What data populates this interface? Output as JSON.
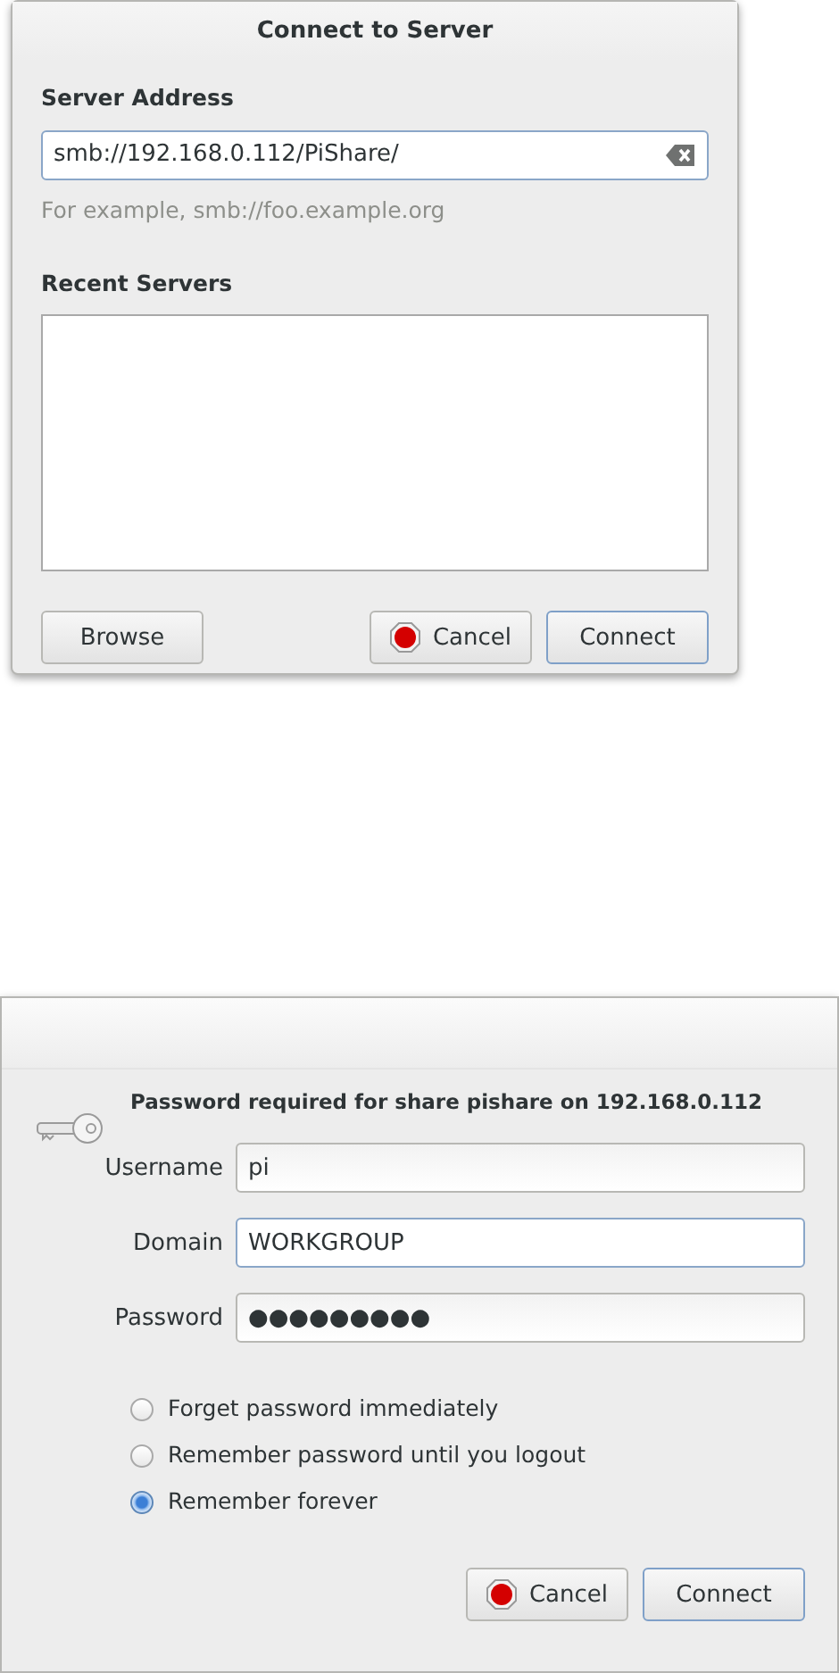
{
  "connect_dialog": {
    "title": "Connect to Server",
    "server_address_label": "Server Address",
    "address_field": {
      "value": "smb://192.168.0.112/PiShare/",
      "focused": true
    },
    "hint": "For example, smb://foo.example.org",
    "recent_servers_label": "Recent Servers",
    "buttons": [
      {
        "label": "Browse",
        "kind": "plain"
      },
      {
        "label": "Cancel",
        "kind": "stop"
      },
      {
        "label": "Connect",
        "kind": "default"
      }
    ]
  },
  "password_dialog": {
    "heading": "Password required for share pishare on 192.168.0.112",
    "fields": [
      {
        "label": "Username",
        "value": "pi",
        "focused": false
      },
      {
        "label": "Domain",
        "value": "WORKGROUP",
        "focused": true
      },
      {
        "label": "Password",
        "value": "●●●●●●●●●",
        "focused": false
      }
    ],
    "options": [
      {
        "label": "Forget password immediately",
        "selected": false
      },
      {
        "label": "Remember password until you logout",
        "selected": false
      },
      {
        "label": "Remember forever",
        "selected": true
      }
    ],
    "buttons": [
      {
        "label": "Cancel",
        "kind": "stop"
      },
      {
        "label": "Connect",
        "kind": "default"
      }
    ]
  }
}
